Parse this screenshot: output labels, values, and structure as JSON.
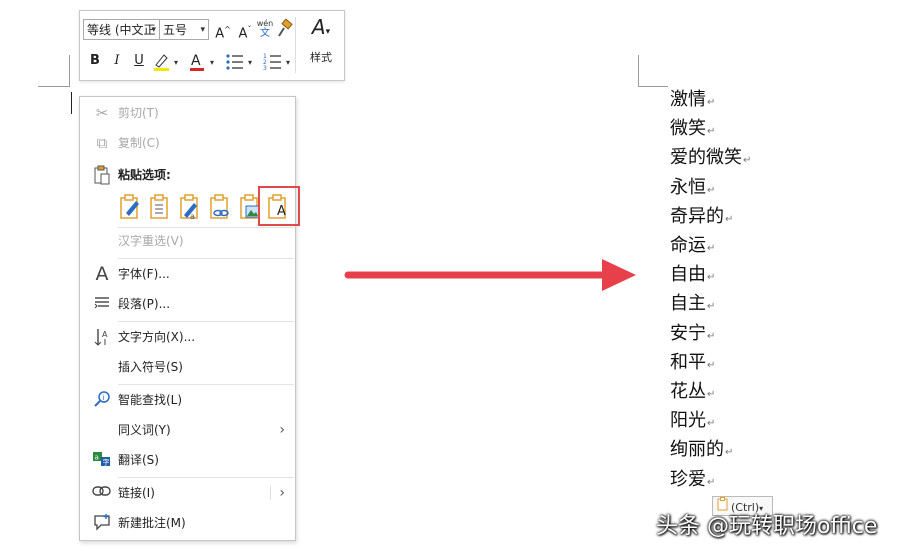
{
  "toolbar": {
    "font_name": "等线 (中文正",
    "font_size": "五号",
    "grow_font": "A",
    "shrink_font": "A",
    "pinyin_top": "wén",
    "pinyin_bottom": "文",
    "bold": "B",
    "italic": "I",
    "underline": "U",
    "font_color_letter": "A",
    "styles_letter": "A",
    "styles_label": "样式",
    "highlight_color": "#f2e700",
    "font_color": "#d62828"
  },
  "context_menu": {
    "cut": "剪切(T)",
    "copy": "复制(C)",
    "paste_options_label": "粘贴选项:",
    "reconvert": "汉字重选(V)",
    "font": "字体(F)...",
    "paragraph": "段落(P)...",
    "text_direction": "文字方向(X)...",
    "insert_symbol": "插入符号(S)",
    "smart_lookup": "智能查找(L)",
    "synonyms": "同义词(Y)",
    "translate": "翻译(S)",
    "link": "链接(I)",
    "new_comment": "新建批注(M)",
    "paste_text_only_letter": "A"
  },
  "document": {
    "lines": [
      "激情",
      "微笑",
      "爱的微笑",
      "永恒",
      "奇异的",
      "命运",
      "自由",
      "自主",
      "安宁",
      "和平",
      "花丛",
      "阳光",
      "绚丽的",
      "珍爱"
    ],
    "paragraph_mark": "↵",
    "paste_ctrl_label": "(Ctrl)"
  },
  "watermark": "头条 @玩转职场office",
  "colors": {
    "arrow": "#e8404a",
    "highlight_box": "#e04a4a",
    "accent_blue": "#2b6cc4",
    "accent_orange": "#e0a030"
  }
}
